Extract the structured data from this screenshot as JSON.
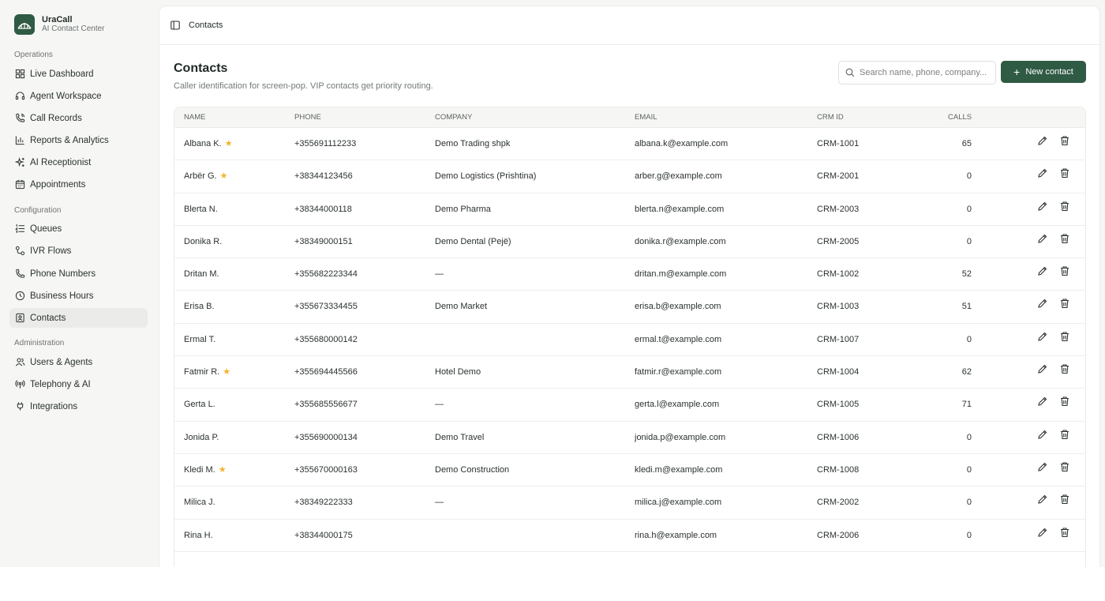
{
  "brand": {
    "name": "UraCall",
    "subtitle": "AI Contact Center"
  },
  "sidebar": {
    "sections": [
      {
        "title": "Operations",
        "items": [
          {
            "label": "Live Dashboard",
            "icon": "grid-icon"
          },
          {
            "label": "Agent Workspace",
            "icon": "headset-icon"
          },
          {
            "label": "Call Records",
            "icon": "phone-call-icon"
          },
          {
            "label": "Reports & Analytics",
            "icon": "bar-chart-icon"
          },
          {
            "label": "AI Receptionist",
            "icon": "sparkles-icon"
          },
          {
            "label": "Appointments",
            "icon": "calendar-icon"
          }
        ]
      },
      {
        "title": "Configuration",
        "items": [
          {
            "label": "Queues",
            "icon": "list-icon"
          },
          {
            "label": "IVR Flows",
            "icon": "flow-icon"
          },
          {
            "label": "Phone Numbers",
            "icon": "phone-icon"
          },
          {
            "label": "Business Hours",
            "icon": "clock-icon"
          },
          {
            "label": "Contacts",
            "icon": "contact-book-icon",
            "active": true
          }
        ]
      },
      {
        "title": "Administration",
        "items": [
          {
            "label": "Users & Agents",
            "icon": "users-icon"
          },
          {
            "label": "Telephony & AI",
            "icon": "antenna-icon"
          },
          {
            "label": "Integrations",
            "icon": "plug-icon"
          }
        ]
      }
    ]
  },
  "topbar": {
    "title": "Contacts"
  },
  "page": {
    "title": "Contacts",
    "subtitle": "Caller identification for screen-pop. VIP contacts get priority routing."
  },
  "search": {
    "placeholder": "Search name, phone, company..."
  },
  "actions": {
    "new_contact": "New contact"
  },
  "colors": {
    "accent": "#2f5a44",
    "star": "#f2b429"
  },
  "table": {
    "columns": [
      "NAME",
      "PHONE",
      "COMPANY",
      "EMAIL",
      "CRM ID",
      "CALLS"
    ],
    "rows": [
      {
        "name": "Albana K.",
        "vip": true,
        "phone": "+355691112233",
        "company": "Demo Trading shpk",
        "email": "albana.k@example.com",
        "crm": "CRM-1001",
        "calls": "65"
      },
      {
        "name": "Arbër G.",
        "vip": true,
        "phone": "+38344123456",
        "company": "Demo Logistics (Prishtina)",
        "email": "arber.g@example.com",
        "crm": "CRM-2001",
        "calls": "0"
      },
      {
        "name": "Blerta N.",
        "vip": false,
        "phone": "+38344000118",
        "company": "Demo Pharma",
        "email": "blerta.n@example.com",
        "crm": "CRM-2003",
        "calls": "0"
      },
      {
        "name": "Donika R.",
        "vip": false,
        "phone": "+38349000151",
        "company": "Demo Dental (Pejë)",
        "email": "donika.r@example.com",
        "crm": "CRM-2005",
        "calls": "0"
      },
      {
        "name": "Dritan M.",
        "vip": false,
        "phone": "+355682223344",
        "company": "—",
        "email": "dritan.m@example.com",
        "crm": "CRM-1002",
        "calls": "52"
      },
      {
        "name": "Erisa B.",
        "vip": false,
        "phone": "+355673334455",
        "company": "Demo Market",
        "email": "erisa.b@example.com",
        "crm": "CRM-1003",
        "calls": "51"
      },
      {
        "name": "Ermal T.",
        "vip": false,
        "phone": "+355680000142",
        "company": "",
        "email": "ermal.t@example.com",
        "crm": "CRM-1007",
        "calls": "0"
      },
      {
        "name": "Fatmir R.",
        "vip": true,
        "phone": "+355694445566",
        "company": "Hotel Demo",
        "email": "fatmir.r@example.com",
        "crm": "CRM-1004",
        "calls": "62"
      },
      {
        "name": "Gerta L.",
        "vip": false,
        "phone": "+355685556677",
        "company": "—",
        "email": "gerta.l@example.com",
        "crm": "CRM-1005",
        "calls": "71"
      },
      {
        "name": "Jonida P.",
        "vip": false,
        "phone": "+355690000134",
        "company": "Demo Travel",
        "email": "jonida.p@example.com",
        "crm": "CRM-1006",
        "calls": "0"
      },
      {
        "name": "Kledi M.",
        "vip": true,
        "phone": "+355670000163",
        "company": "Demo Construction",
        "email": "kledi.m@example.com",
        "crm": "CRM-1008",
        "calls": "0"
      },
      {
        "name": "Milica J.",
        "vip": false,
        "phone": "+38349222333",
        "company": "—",
        "email": "milica.j@example.com",
        "crm": "CRM-2002",
        "calls": "0"
      },
      {
        "name": "Rina H.",
        "vip": false,
        "phone": "+38344000175",
        "company": "",
        "email": "rina.h@example.com",
        "crm": "CRM-2006",
        "calls": "0"
      }
    ]
  }
}
